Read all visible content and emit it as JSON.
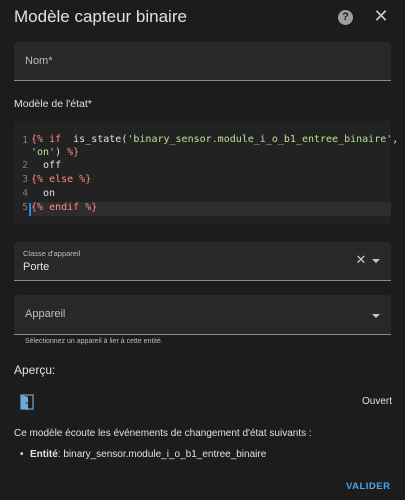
{
  "dialog": {
    "title": "Modèle capteur binaire",
    "help_icon": "help-circle-icon",
    "close_icon": "close-icon"
  },
  "name_field": {
    "label": "Nom*",
    "value": ""
  },
  "state_template": {
    "label": "Modèle de l'état*",
    "line_numbers": [
      "1",
      "2",
      "3",
      "4",
      "5"
    ],
    "lines": [
      {
        "tag_open": "{%",
        "kw": " if ",
        "fn": " is_state(",
        "arg1": "'binary_sensor.module_i_o_b1_entree_binaire'",
        "sep": ",",
        "arg2": "'on'",
        "close": ")",
        "tag_close": " %}"
      },
      {
        "text": "  off"
      },
      {
        "tag_open": "{%",
        "kw": " else ",
        "tag_close": "%}"
      },
      {
        "text": "  on"
      },
      {
        "tag_open": "{%",
        "kw": " endif ",
        "tag_close": "%}"
      }
    ]
  },
  "device_class": {
    "label": "Classe d'appareil",
    "value": "Porte",
    "clear_icon": "clear-icon",
    "dropdown_icon": "chevron-down-icon"
  },
  "device": {
    "label": "Appareil",
    "value": "",
    "helper": "Sélectionnez un appareil à lier à cette entité.",
    "dropdown_icon": "chevron-down-icon"
  },
  "preview": {
    "label": "Aperçu:",
    "icon": "door-open-icon",
    "state": "Ouvert"
  },
  "listeners": {
    "intro": "Ce modèle écoute les événements de changement d'état suivants :",
    "items": [
      {
        "prefix": "Entité",
        "value": "binary_sensor.module_i_o_b1_entree_binaire"
      }
    ]
  },
  "actions": {
    "submit_label": "VALIDER"
  },
  "colors": {
    "background": "#1c1c1c",
    "field": "#282828",
    "accent": "#4aa3f0",
    "keyword": "#ff8a8a",
    "string": "#b9e28f"
  }
}
